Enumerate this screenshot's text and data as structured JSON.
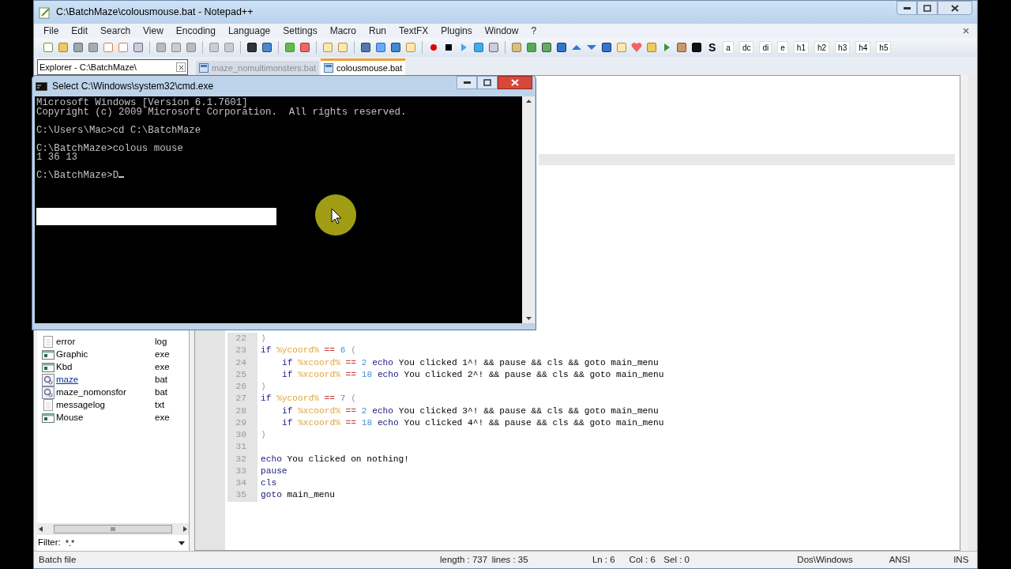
{
  "window": {
    "title": "C:\\BatchMaze\\colousmouse.bat - Notepad++"
  },
  "menu": [
    "File",
    "Edit",
    "Search",
    "View",
    "Encoding",
    "Language",
    "Settings",
    "Macro",
    "Run",
    "TextFX",
    "Plugins",
    "Window",
    "?"
  ],
  "toolbar": {
    "text_buttons": [
      "S",
      "a",
      "dc",
      "di",
      "e",
      "h1",
      "h2",
      "h3",
      "h4",
      "h5"
    ]
  },
  "explorer": {
    "title": "Explorer - C:\\BatchMaze\\",
    "files": [
      {
        "name": "error",
        "ext": "log",
        "kind": "text",
        "hovered": false
      },
      {
        "name": "Graphic",
        "ext": "exe",
        "kind": "exe",
        "hovered": false
      },
      {
        "name": "Kbd",
        "ext": "exe",
        "kind": "exe",
        "hovered": false
      },
      {
        "name": "maze",
        "ext": "bat",
        "kind": "bat",
        "hovered": true
      },
      {
        "name": "maze_nomonsfor",
        "ext": "bat",
        "kind": "bat",
        "hovered": false
      },
      {
        "name": "messagelog",
        "ext": "txt",
        "kind": "text",
        "hovered": false
      },
      {
        "name": "Mouse",
        "ext": "exe",
        "kind": "exe",
        "hovered": false
      }
    ],
    "filter_label": "Filter:",
    "filter_value": "*.*"
  },
  "tabs": [
    {
      "label": "maze_nomultimonsters.bat",
      "selected": false
    },
    {
      "label": "colousmouse.bat",
      "selected": true
    }
  ],
  "code_lines": [
    {
      "num": "22",
      "indent": false,
      "tokens": [
        {
          "kind": "paren",
          "text": ")"
        }
      ]
    },
    {
      "num": "23",
      "indent": false,
      "tokens": [
        {
          "kind": "keyword",
          "text": "if"
        },
        {
          "kind": "var",
          "text": "%ycoord%"
        },
        {
          "kind": "op",
          "text": "=="
        },
        {
          "kind": "num",
          "text": "6"
        },
        {
          "kind": "paren",
          "text": "("
        }
      ]
    },
    {
      "num": "24",
      "indent": true,
      "tokens": [
        {
          "kind": "keyword",
          "text": "if"
        },
        {
          "kind": "var",
          "text": "%xcoord%"
        },
        {
          "kind": "op",
          "text": "=="
        },
        {
          "kind": "num",
          "text": "2"
        },
        {
          "kind": "keyword",
          "text": "echo"
        },
        {
          "kind": "plain",
          "text": "You clicked 1^! && pause && cls && goto main_menu"
        }
      ]
    },
    {
      "num": "25",
      "indent": true,
      "tokens": [
        {
          "kind": "keyword",
          "text": "if"
        },
        {
          "kind": "var",
          "text": "%xcoord%"
        },
        {
          "kind": "op",
          "text": "=="
        },
        {
          "kind": "num",
          "text": "18"
        },
        {
          "kind": "keyword",
          "text": "echo"
        },
        {
          "kind": "plain",
          "text": "You clicked 2^! && pause && cls && goto main_menu"
        }
      ]
    },
    {
      "num": "26",
      "indent": false,
      "tokens": [
        {
          "kind": "paren",
          "text": ")"
        }
      ]
    },
    {
      "num": "27",
      "indent": false,
      "tokens": [
        {
          "kind": "keyword",
          "text": "if"
        },
        {
          "kind": "var",
          "text": "%ycoord%"
        },
        {
          "kind": "op",
          "text": "=="
        },
        {
          "kind": "num",
          "text": "7"
        },
        {
          "kind": "paren",
          "text": "("
        }
      ]
    },
    {
      "num": "28",
      "indent": true,
      "tokens": [
        {
          "kind": "keyword",
          "text": "if"
        },
        {
          "kind": "var",
          "text": "%xcoord%"
        },
        {
          "kind": "op",
          "text": "=="
        },
        {
          "kind": "num",
          "text": "2"
        },
        {
          "kind": "keyword",
          "text": "echo"
        },
        {
          "kind": "plain",
          "text": "You clicked 3^! && pause && cls && goto main_menu"
        }
      ]
    },
    {
      "num": "29",
      "indent": true,
      "tokens": [
        {
          "kind": "keyword",
          "text": "if"
        },
        {
          "kind": "var",
          "text": "%xcoord%"
        },
        {
          "kind": "op",
          "text": "=="
        },
        {
          "kind": "num",
          "text": "18"
        },
        {
          "kind": "keyword",
          "text": "echo"
        },
        {
          "kind": "plain",
          "text": "You clicked 4^! && pause && cls && goto main_menu"
        }
      ]
    },
    {
      "num": "30",
      "indent": false,
      "tokens": [
        {
          "kind": "paren",
          "text": ")"
        }
      ]
    },
    {
      "num": "31"
    },
    {
      "num": "32",
      "indent": false,
      "tokens": [
        {
          "kind": "keyword",
          "text": "echo"
        },
        {
          "kind": "plain",
          "text": "You clicked on nothing!"
        }
      ]
    },
    {
      "num": "33",
      "indent": false,
      "tokens": [
        {
          "kind": "keyword",
          "text": "pause"
        }
      ]
    },
    {
      "num": "34",
      "indent": false,
      "tokens": [
        {
          "kind": "keyword",
          "text": "cls"
        }
      ]
    },
    {
      "num": "35",
      "indent": false,
      "tokens": [
        {
          "kind": "keyword",
          "text": "goto"
        },
        {
          "kind": "plain",
          "text": "main_menu"
        }
      ]
    }
  ],
  "status_bar": [
    "Batch file",
    "length : 737",
    "lines : 35",
    "Ln : 6",
    "Col : 6",
    "Sel : 0",
    "Dos\\Windows",
    "ANSI",
    "INS"
  ],
  "console": {
    "title": "Select C:\\Windows\\system32\\cmd.exe",
    "lines": [
      {
        "text": "Microsoft Windows [Version 6.1.7601]",
        "blank_before": false
      },
      {
        "text": "Copyright (c) 2009 Microsoft Corporation.  All rights reserved.",
        "blank_before": false
      },
      {
        "text": "C:\\Users\\Mac>cd C:\\BatchMaze",
        "blank_before": true
      },
      {
        "text": "C:\\BatchMaze>colous mouse",
        "blank_before": true
      },
      {
        "text": "1 36 13",
        "blank_before": false
      },
      {
        "text": "C:\\BatchMaze>D",
        "blank_before": true
      }
    ]
  }
}
